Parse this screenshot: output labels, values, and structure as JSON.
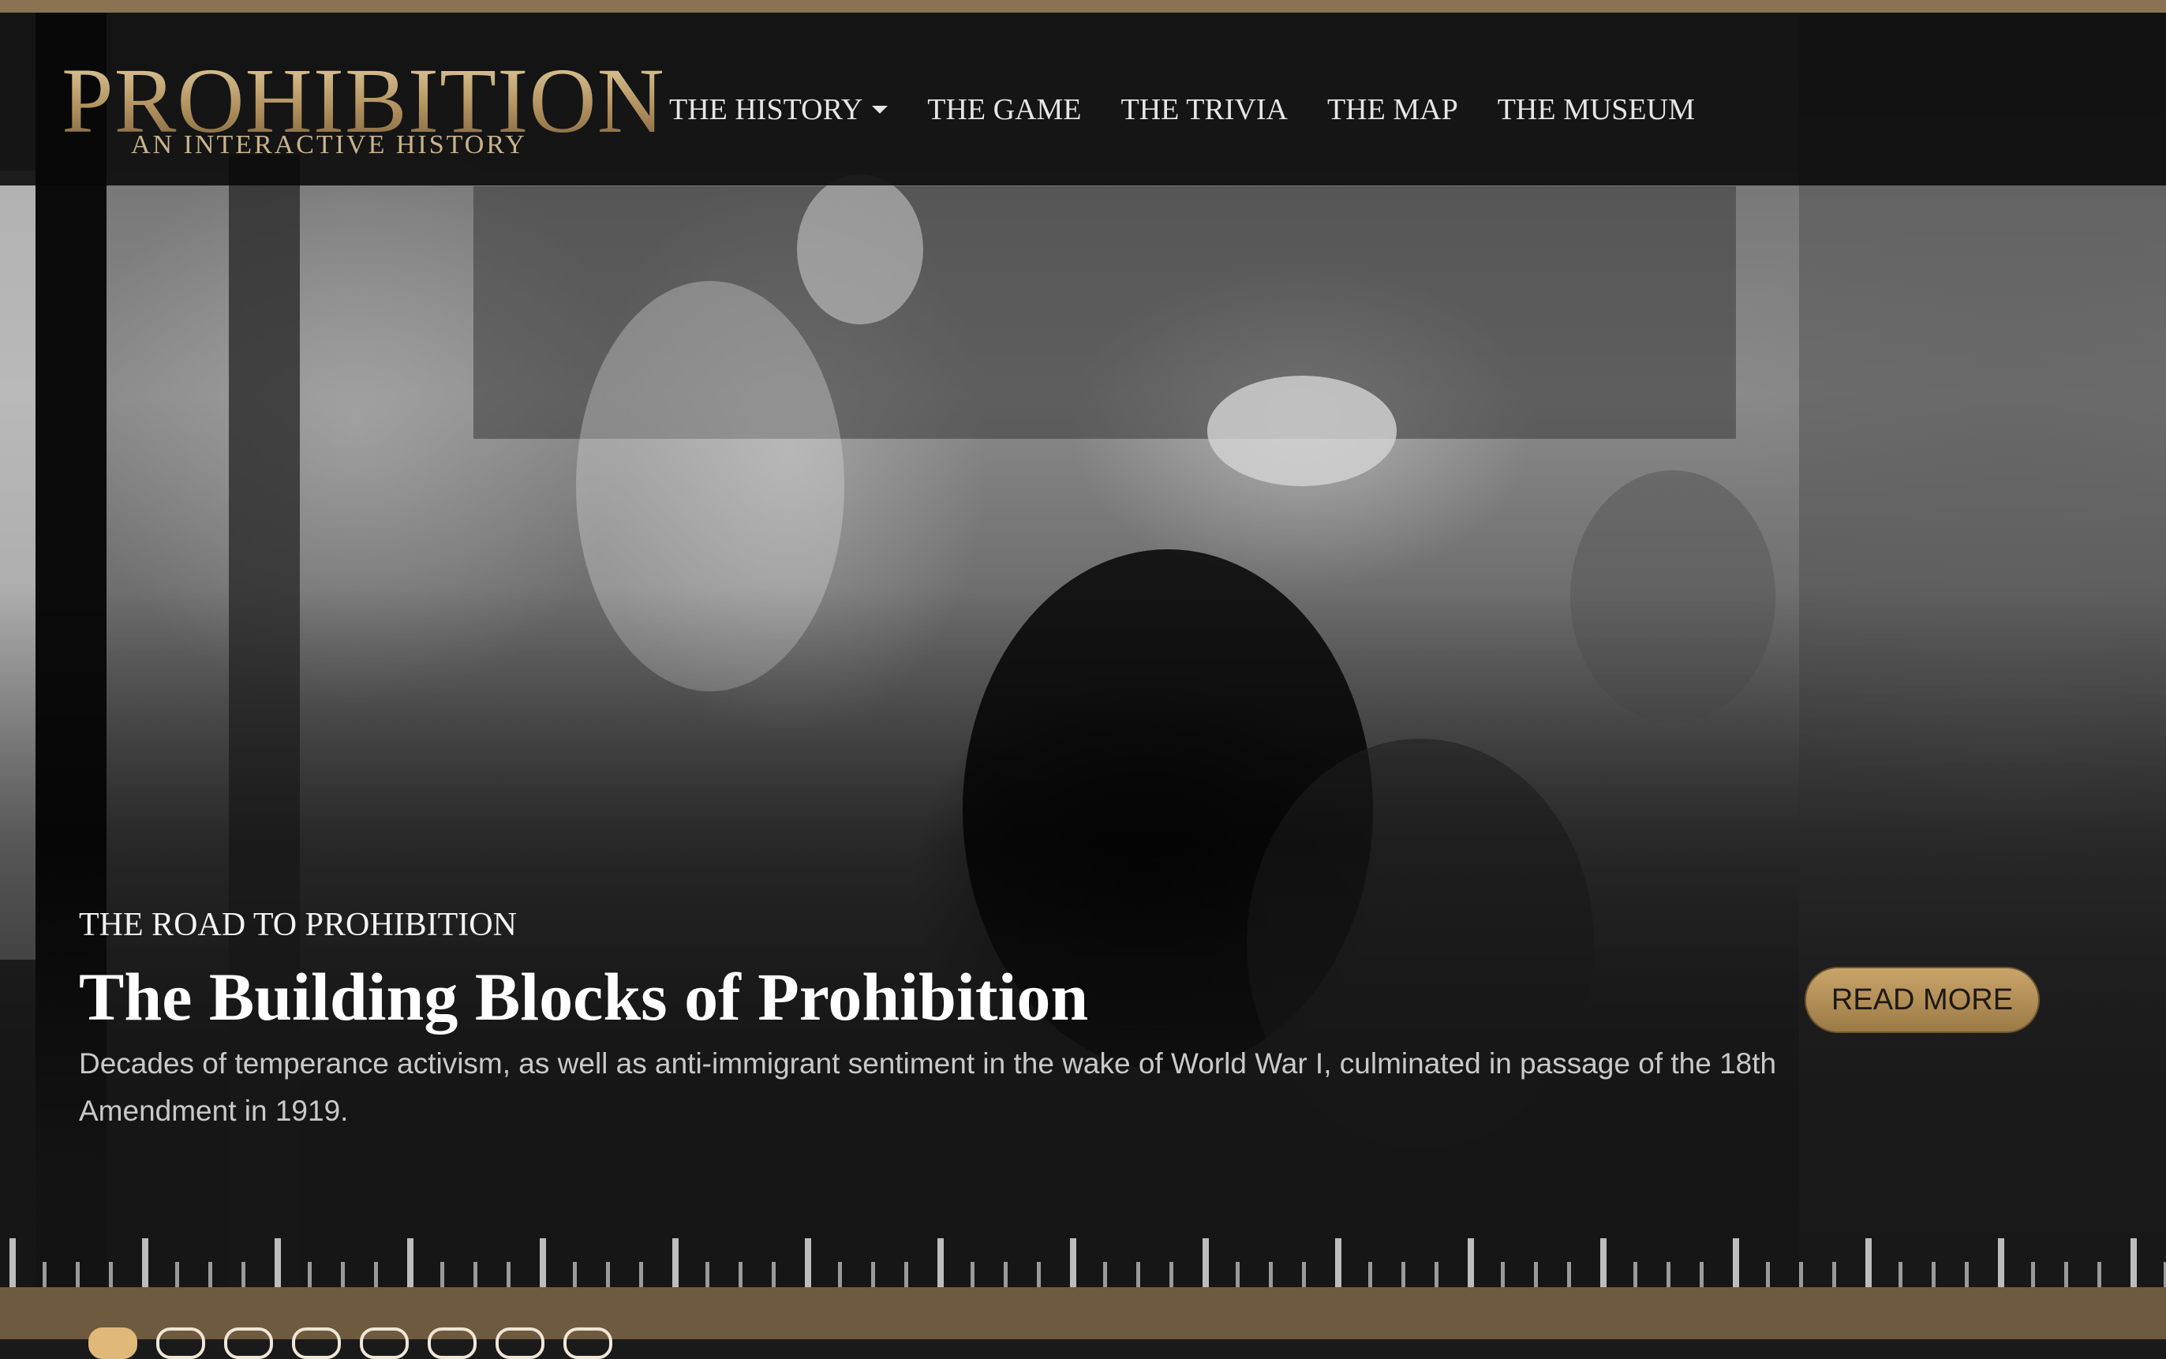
{
  "colors": {
    "accent_gold": "#b3935f",
    "nav_background": "#080808",
    "footer_bar": "#6e5a3e",
    "button_gold": "#c9a56a"
  },
  "logo": {
    "title": "PROHIBITION",
    "subtitle": "AN INTERACTIVE HISTORY"
  },
  "nav": {
    "items": [
      {
        "label": "THE HISTORY",
        "has_dropdown": true
      },
      {
        "label": "THE GAME"
      },
      {
        "label": "THE TRIVIA"
      },
      {
        "label": "THE MAP"
      },
      {
        "label": "THE MUSEUM"
      }
    ]
  },
  "hero": {
    "kicker": "THE ROAD TO PROHIBITION",
    "title": "The Building Blocks of Prohibition",
    "summary": "Decades of temperance activism, as well as anti-immigrant sentiment in the wake of World War I, culminated in passage of the 18th Amendment in 1919.",
    "button_label": "READ MORE"
  },
  "carousel": {
    "slide_count": 8,
    "active_index": 0
  }
}
